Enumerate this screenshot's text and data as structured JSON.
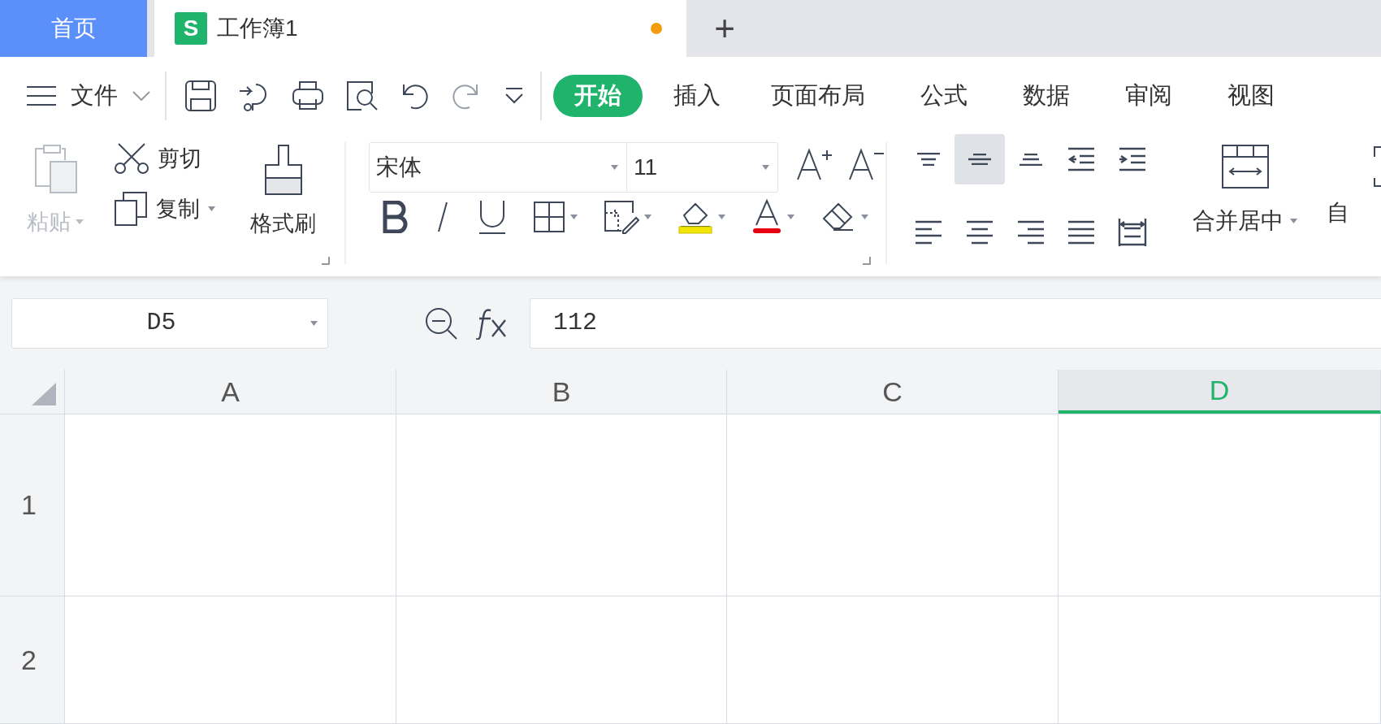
{
  "tabs": [
    {
      "kind": "home",
      "label": "首页",
      "selected": false
    },
    {
      "kind": "document",
      "label": "工作簿1",
      "icon_text": "S",
      "selected": true,
      "unsaved": true
    }
  ],
  "new_tab_button": "+",
  "menu": {
    "file_label": "文件",
    "tabs": [
      {
        "label": "开始",
        "selected": true
      },
      {
        "label": "插入",
        "selected": false
      },
      {
        "label": "页面布局",
        "selected": false
      },
      {
        "label": "公式",
        "selected": false
      },
      {
        "label": "数据",
        "selected": false
      },
      {
        "label": "审阅",
        "selected": false
      },
      {
        "label": "视图",
        "selected": false
      }
    ]
  },
  "ribbon": {
    "paste": {
      "label": "粘贴",
      "disabled": true
    },
    "cut": "剪切",
    "copy": "复制",
    "format_painter": "格式刷",
    "font_name": "宋体",
    "font_size": "11",
    "align_buttons": [
      {
        "kind": "top",
        "selected": false
      },
      {
        "kind": "middle",
        "selected": true
      },
      {
        "kind": "bottom",
        "selected": false
      },
      {
        "kind": "outdent",
        "selected": false
      },
      {
        "kind": "indent",
        "selected": false
      },
      {
        "kind": "left",
        "selected": false
      },
      {
        "kind": "center",
        "selected": false
      },
      {
        "kind": "right",
        "selected": false
      },
      {
        "kind": "justify",
        "selected": false
      },
      {
        "kind": "distributed",
        "selected": false
      }
    ],
    "merge": "合并居中",
    "wrap": "自"
  },
  "formula_bar": {
    "cell_reference": "D5",
    "formula": "112"
  },
  "sheet": {
    "columns": [
      {
        "label": "A",
        "selected": false
      },
      {
        "label": "B",
        "selected": false
      },
      {
        "label": "C",
        "selected": false
      },
      {
        "label": "D",
        "selected": true
      }
    ],
    "rows": [
      "1",
      "2"
    ]
  }
}
